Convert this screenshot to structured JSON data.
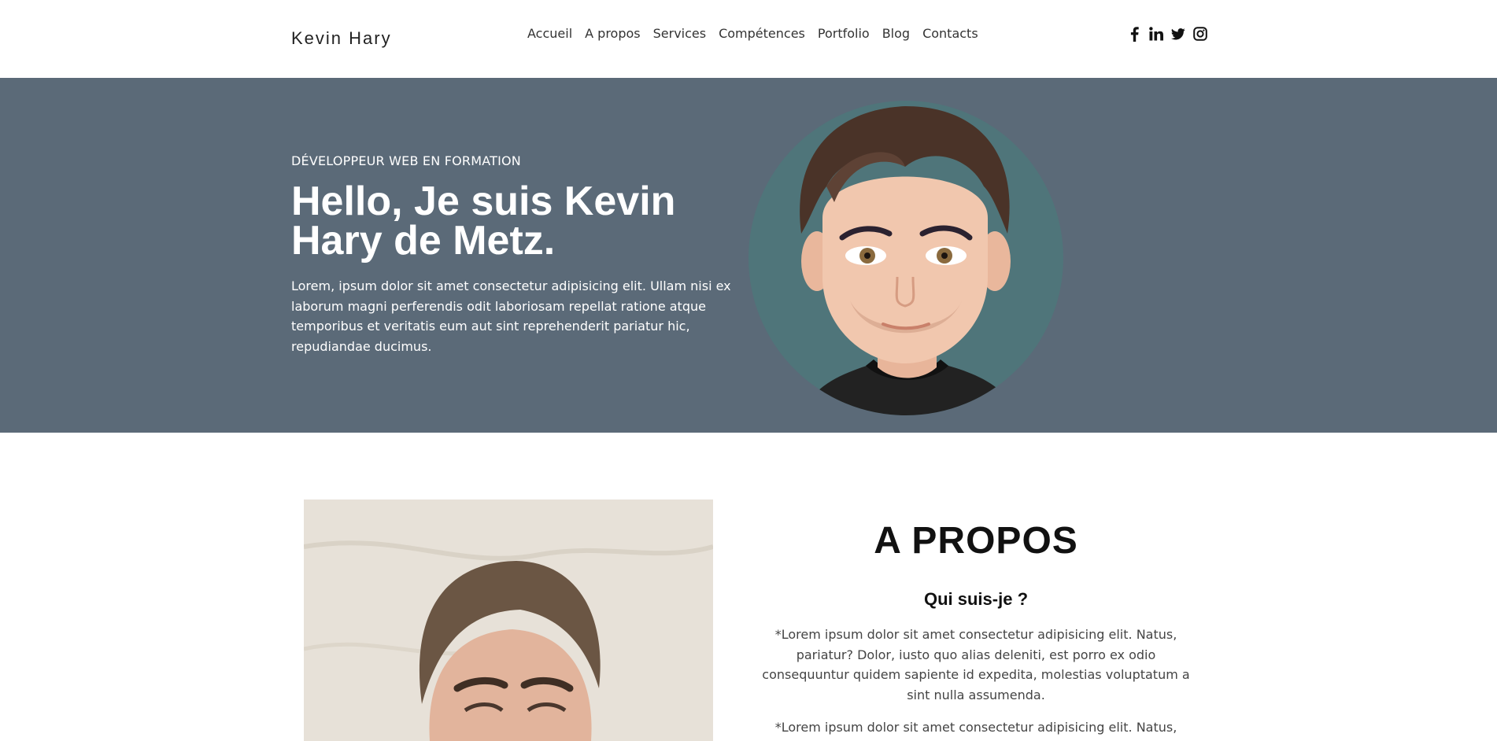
{
  "header": {
    "brand": "Kevin Hary",
    "nav": [
      "Accueil",
      "A propos",
      "Services",
      "Compétences",
      "Portfolio",
      "Blog",
      "Contacts"
    ],
    "social_icons": [
      "facebook-icon",
      "linkedin-icon",
      "twitter-icon",
      "instagram-icon"
    ]
  },
  "hero": {
    "subtitle": "DÉVELOPPEUR WEB EN FORMATION",
    "title": "Hello, Je suis Kevin Hary de Metz.",
    "text": "Lorem, ipsum dolor sit amet consectetur adipisicing elit. Ullam nisi ex laborum magni perferendis odit laboriosam repellat ratione atque temporibus et veritatis eum aut sint reprehenderit pariatur hic, repudiandae ducimus."
  },
  "about": {
    "title": "A PROPOS",
    "subtitle": "Qui suis-je ?",
    "paragraphs": [
      "*Lorem ipsum dolor sit amet consectetur adipisicing elit. Natus, pariatur? Dolor, iusto quo alias deleniti, est porro ex odio consequuntur quidem sapiente id expedita, molestias voluptatum a sint nulla assumenda.",
      "*Lorem ipsum dolor sit amet consectetur adipisicing elit. Natus,"
    ]
  },
  "colors": {
    "hero_bg": "#5b6a78",
    "avatar_circle": "#4f757a"
  }
}
